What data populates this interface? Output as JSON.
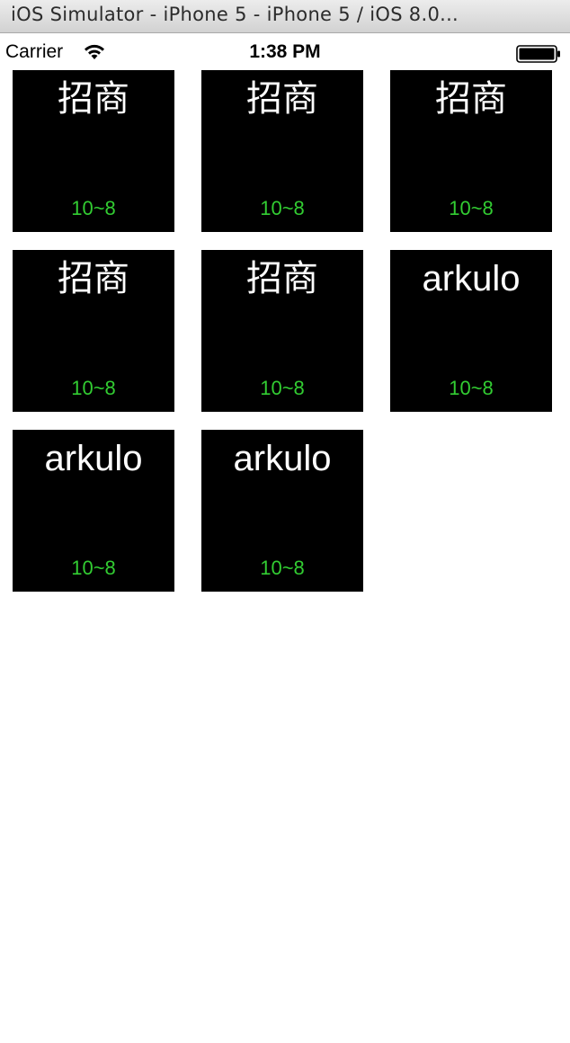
{
  "window": {
    "title": "iOS Simulator - iPhone 5 - iPhone 5 / iOS 8.0..."
  },
  "status_bar": {
    "carrier": "Carrier",
    "time": "1:38 PM",
    "wifi_icon": "wifi-icon",
    "battery_icon": "battery-icon"
  },
  "colors": {
    "tile_background": "#000000",
    "tile_title": "#ffffff",
    "tile_subtitle": "#32cd32",
    "page_background": "#ffffff"
  },
  "tiles": [
    {
      "title": "招商",
      "subtitle": "10~8"
    },
    {
      "title": "招商",
      "subtitle": "10~8"
    },
    {
      "title": "招商",
      "subtitle": "10~8"
    },
    {
      "title": "招商",
      "subtitle": "10~8"
    },
    {
      "title": "招商",
      "subtitle": "10~8"
    },
    {
      "title": "arkulo",
      "subtitle": "10~8"
    },
    {
      "title": "arkulo",
      "subtitle": "10~8"
    },
    {
      "title": "arkulo",
      "subtitle": "10~8"
    }
  ]
}
